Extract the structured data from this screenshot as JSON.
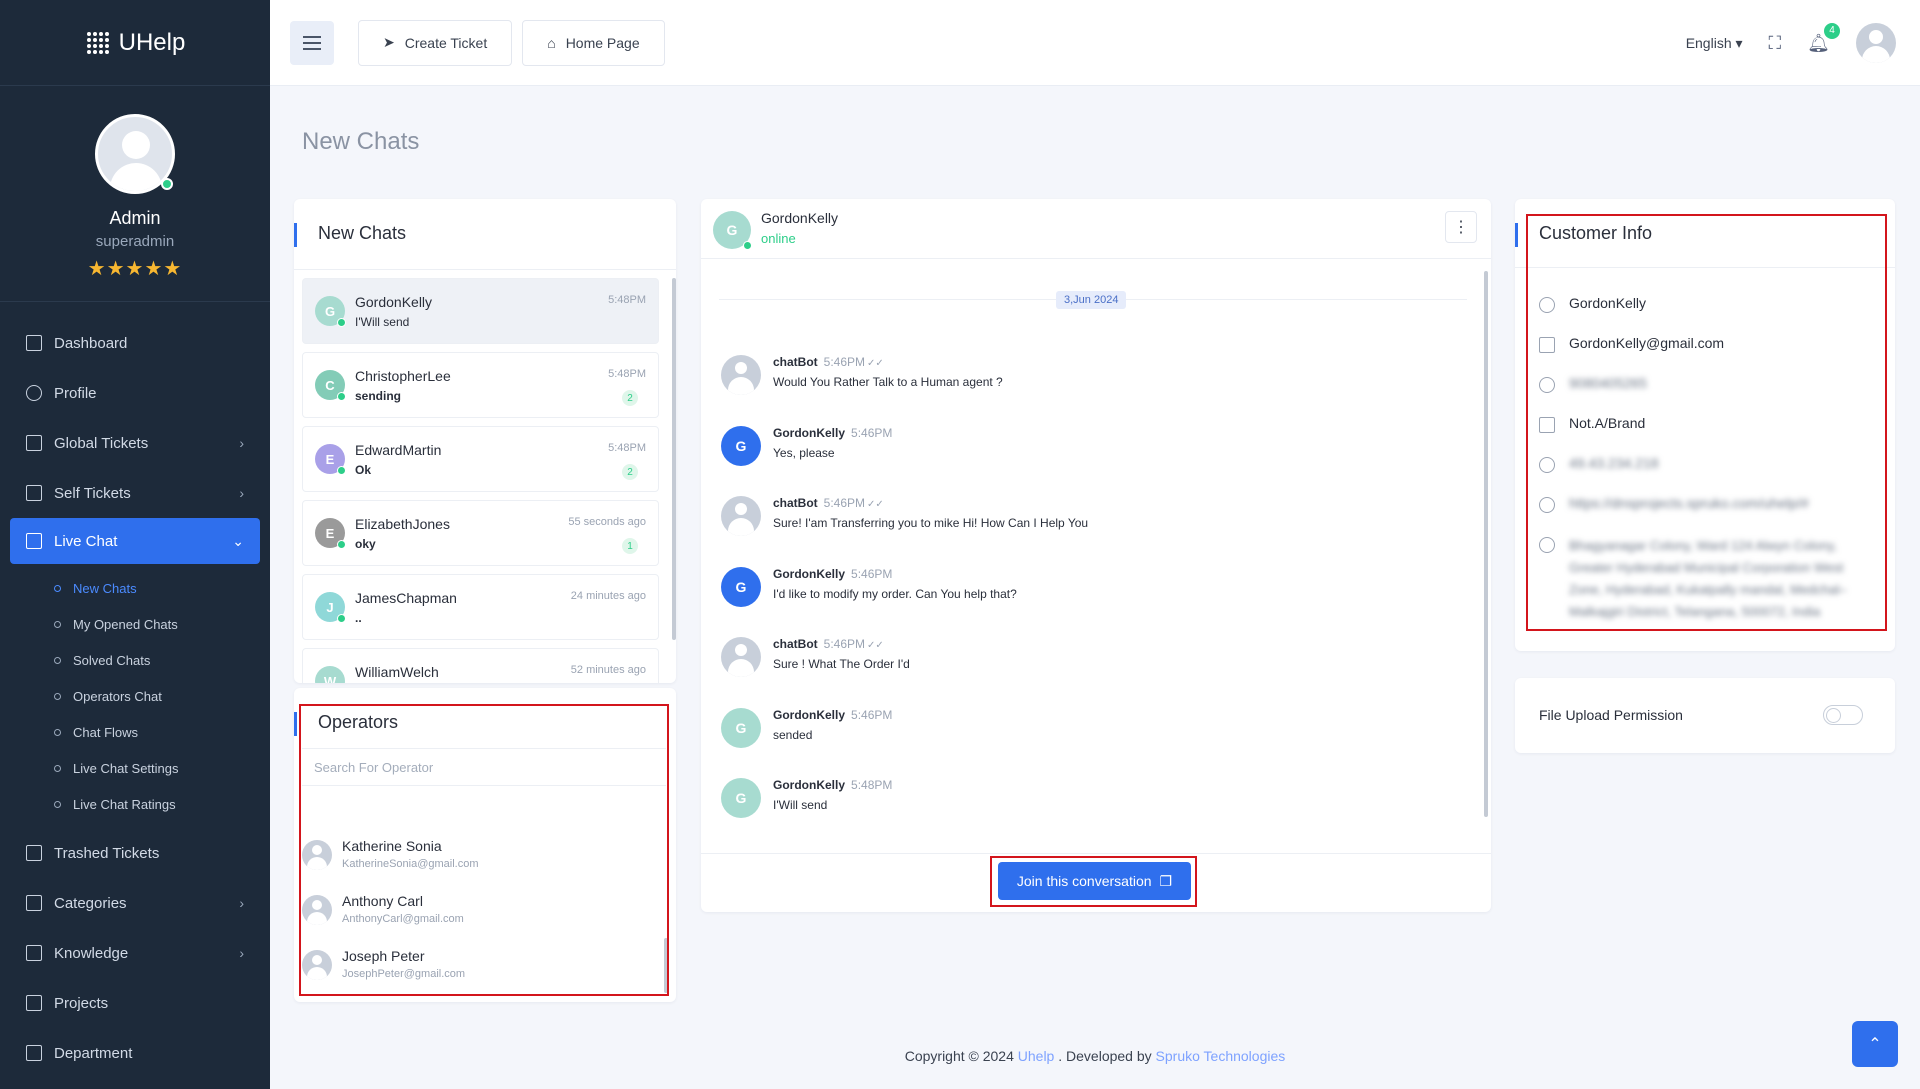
{
  "brand": {
    "name": "UHelp"
  },
  "user": {
    "name": "Admin",
    "role": "superadmin",
    "rating": "★★★★★"
  },
  "sidebar": {
    "items": [
      {
        "label": "Dashboard"
      },
      {
        "label": "Profile"
      },
      {
        "label": "Global Tickets",
        "chevron": "›"
      },
      {
        "label": "Self Tickets",
        "chevron": "›"
      },
      {
        "label": "Live Chat",
        "chevron": "⌄"
      },
      {
        "label": "Trashed Tickets"
      },
      {
        "label": "Categories",
        "chevron": "›"
      },
      {
        "label": "Knowledge",
        "chevron": "›"
      },
      {
        "label": "Projects"
      },
      {
        "label": "Department"
      }
    ],
    "live_chat_sub": [
      "New Chats",
      "My Opened Chats",
      "Solved Chats",
      "Operators Chat",
      "Chat Flows",
      "Live Chat Settings",
      "Live Chat Ratings"
    ]
  },
  "header": {
    "create_ticket": "Create Ticket",
    "home_page": "Home Page",
    "language": "English",
    "notification_count": "4"
  },
  "page": {
    "title": "New Chats"
  },
  "new_chats": {
    "title": "New Chats",
    "items": [
      {
        "initial": "G",
        "name": "GordonKelly",
        "message": "I'Will send",
        "time": "5:48PM",
        "count": "",
        "color": "#a7dbd0"
      },
      {
        "initial": "C",
        "name": "ChristopherLee",
        "message": "sending",
        "time": "5:48PM",
        "count": "2",
        "color": "#83ccb7"
      },
      {
        "initial": "E",
        "name": "EdwardMartin",
        "message": "Ok",
        "time": "5:48PM",
        "count": "2",
        "color": "#a9a0e8"
      },
      {
        "initial": "E",
        "name": "ElizabethJones",
        "message": "oky",
        "time": "55 seconds ago",
        "count": "1",
        "color": "#9a9a9a"
      },
      {
        "initial": "J",
        "name": "JamesChapman",
        "message": "..",
        "time": "24 minutes ago",
        "count": "",
        "color": "#8fd8d8"
      },
      {
        "initial": "W",
        "name": "WilliamWelch",
        "message": "",
        "time": "52 minutes ago",
        "count": "",
        "color": "#a7dbd0"
      }
    ]
  },
  "operators": {
    "title": "Operators",
    "search_placeholder": "Search For Operator",
    "items": [
      {
        "name": "Katherine Sonia",
        "email": "KatherineSonia@gmail.com"
      },
      {
        "name": "Anthony Carl",
        "email": "AnthonyCarl@gmail.com"
      },
      {
        "name": "Joseph Peter",
        "email": "JosephPeter@gmail.com"
      }
    ]
  },
  "conversation": {
    "user_initial": "G",
    "user_name": "GordonKelly",
    "status": "online",
    "date": "3,Jun 2024",
    "messages": [
      {
        "sender": "chatBot",
        "time": "5:46PM",
        "text": "Would You Rather Talk to a Human agent ?",
        "bot": true
      },
      {
        "sender": "GordonKelly",
        "time": "5:46PM",
        "text": "Yes, please",
        "initial": "G",
        "color": "#2f6fed"
      },
      {
        "sender": "chatBot",
        "time": "5:46PM",
        "text": "Sure! I'am Transferring you to mike Hi! How Can I Help You",
        "bot": true
      },
      {
        "sender": "GordonKelly",
        "time": "5:46PM",
        "text": "I'd like to modify my order. Can You help that?",
        "initial": "G",
        "color": "#2f6fed"
      },
      {
        "sender": "chatBot",
        "time": "5:46PM",
        "text": "Sure ! What The Order I'd",
        "bot": true
      },
      {
        "sender": "GordonKelly",
        "time": "5:46PM",
        "text": "sended",
        "initial": "G",
        "color": "#a7dbd0"
      },
      {
        "sender": "GordonKelly",
        "time": "5:48PM",
        "text": "I'Will send",
        "initial": "G",
        "color": "#a7dbd0"
      }
    ],
    "join_label": "Join this conversation"
  },
  "customer_info": {
    "title": "Customer Info",
    "name": "GordonKelly",
    "email": "GordonKelly@gmail.com",
    "phone": "9080405265",
    "device": "Not.A/Brand",
    "ip": "49.43.234.218",
    "url": "https://dnsprojects.spruko.com/uhelp/#",
    "address": "Bhagyanagar Colony, Ward 124 Alwyn Colony, Greater Hyderabad Municipal Corporation West Zone, Hyderabad, Kukatpally mandal, Medchal–Malkajgiri District, Telangana, 500072, India"
  },
  "file_upload": {
    "label": "File Upload Permission"
  },
  "footer": {
    "prefix": "Copyright © 2024",
    "brand": "Uhelp",
    "middle": ". Developed by",
    "company": "Spruko Technologies"
  },
  "colors": {
    "accent": "#2f6fed",
    "sidebar": "#1d2a3a",
    "online": "#2dce89",
    "highlight": "#d3151c"
  }
}
